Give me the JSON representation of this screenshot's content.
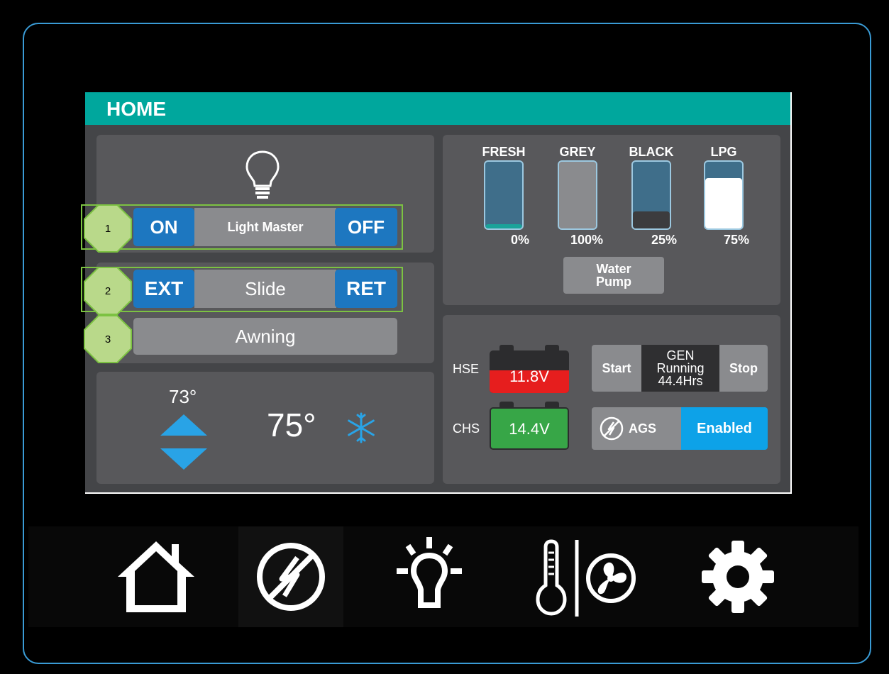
{
  "header": {
    "title": "HOME"
  },
  "annotations": [
    "1",
    "2",
    "3"
  ],
  "lighting": {
    "icon": "lightbulb-icon",
    "on_label": "ON",
    "name": "Light Master",
    "off_label": "OFF"
  },
  "slide": {
    "ext_label": "EXT",
    "name": "Slide",
    "ret_label": "RET"
  },
  "awning": {
    "label": "Awning"
  },
  "climate": {
    "setpoint": "73°",
    "current": "75°",
    "mode_icon": "snowflake-icon",
    "mode_color": "#29a3e6"
  },
  "tanks": [
    {
      "label": "FRESH",
      "level": 0.05,
      "percent": "0%",
      "fill_color": "#1aa39a",
      "bg_color": "#3f6e8a"
    },
    {
      "label": "GREY",
      "level": 1.0,
      "percent": "100%",
      "fill_color": "#8a8b8e",
      "bg_color": "#8a8b8e"
    },
    {
      "label": "BLACK",
      "level": 0.25,
      "percent": "25%",
      "fill_color": "#3c3c3e",
      "bg_color": "#3f6e8a"
    },
    {
      "label": "LPG",
      "level": 0.75,
      "percent": "75%",
      "fill_color": "#ffffff",
      "bg_color": "#3f6e8a"
    }
  ],
  "water_pump": {
    "label_line1": "Water",
    "label_line2": "Pump"
  },
  "batteries": {
    "house": {
      "label": "HSE",
      "voltage": "11.8V",
      "color": "#e61e1e"
    },
    "chassis": {
      "label": "CHS",
      "voltage": "14.4V",
      "color": "#37a647"
    }
  },
  "generator": {
    "start_label": "Start",
    "status_line1": "GEN",
    "status_line2": "Running",
    "status_line3": "44.4Hrs",
    "stop_label": "Stop"
  },
  "ags": {
    "label": "AGS",
    "state": "Enabled",
    "state_color": "#0da2e8"
  },
  "nav": [
    {
      "icon": "home-icon"
    },
    {
      "icon": "power-icon"
    },
    {
      "icon": "light-icon"
    },
    {
      "icon": "thermometer-fan-icon"
    },
    {
      "icon": "gear-icon"
    }
  ]
}
